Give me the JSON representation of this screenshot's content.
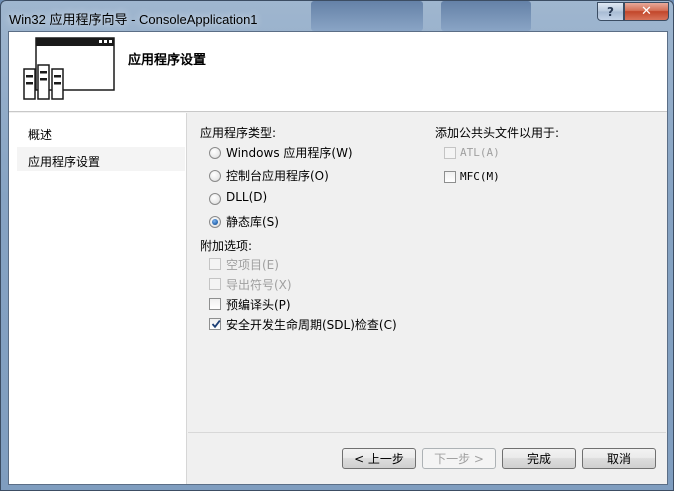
{
  "window": {
    "title": "Win32 应用程序向导 - ConsoleApplication1",
    "help_label": "?",
    "close_label": "✕"
  },
  "header": {
    "title": "应用程序设置",
    "icon": "wizard-window-icon"
  },
  "nav": {
    "items": [
      {
        "label": "概述",
        "selected": false
      },
      {
        "label": "应用程序设置",
        "selected": true
      }
    ]
  },
  "app_type": {
    "label": "应用程序类型:",
    "options": [
      {
        "label": "Windows 应用程序(W)",
        "checked": false
      },
      {
        "label": "控制台应用程序(O)",
        "checked": false
      },
      {
        "label": "DLL(D)",
        "checked": false
      },
      {
        "label": "静态库(S)",
        "checked": true
      }
    ]
  },
  "extra_options": {
    "label": "附加选项:",
    "options": [
      {
        "label": "空项目(E)",
        "checked": false,
        "enabled": false
      },
      {
        "label": "导出符号(X)",
        "checked": false,
        "enabled": false
      },
      {
        "label": "预编译头(P)",
        "checked": false,
        "enabled": true
      },
      {
        "label": "安全开发生命周期(SDL)检查(C)",
        "checked": true,
        "enabled": true
      }
    ]
  },
  "common_headers": {
    "label": "添加公共头文件以用于:",
    "options": [
      {
        "label": "ATL(A)",
        "checked": false,
        "enabled": false
      },
      {
        "label": "MFC(M)",
        "checked": false,
        "enabled": true
      }
    ]
  },
  "buttons": {
    "prev": "< 上一步",
    "next": "下一步 >",
    "finish": "完成",
    "cancel": "取消"
  },
  "colors": {
    "radio_selected": "#1f5fa9",
    "disabled_text": "#a0a0a0"
  }
}
